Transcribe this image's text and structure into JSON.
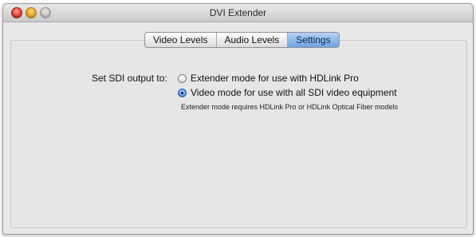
{
  "window": {
    "title": "DVI Extender"
  },
  "tabs": [
    {
      "label": "Video Levels",
      "active": false
    },
    {
      "label": "Audio Levels",
      "active": false
    },
    {
      "label": "Settings",
      "active": true
    }
  ],
  "settings": {
    "sdi_output_label": "Set SDI output to:",
    "options": [
      {
        "label": "Extender mode for use with HDLink Pro",
        "selected": false
      },
      {
        "label": "Video mode for use with all SDI video equipment",
        "selected": true
      }
    ],
    "note": "Extender mode requires HDLink Pro or HDLink Optical Fiber models"
  }
}
